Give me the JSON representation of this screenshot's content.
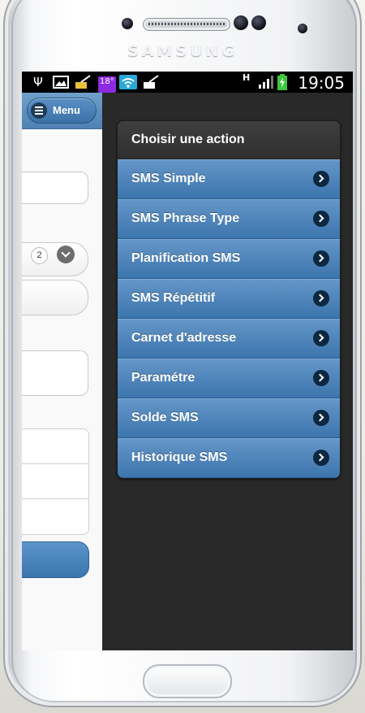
{
  "device": {
    "brand": "SAMSUNG"
  },
  "status_bar": {
    "time": "19:05",
    "temperature": "18°",
    "network": "H",
    "icons": [
      "usb-icon",
      "image-icon",
      "broom-icon",
      "temperature-badge",
      "wifi-icon",
      "clean-icon",
      "network-h-icon",
      "signal-bars-icon",
      "battery-charging-icon"
    ]
  },
  "app": {
    "header": {
      "menu_label": "Menu"
    },
    "count_badge": "2"
  },
  "panel": {
    "title": "Choisir une action",
    "items": [
      {
        "label": "SMS Simple"
      },
      {
        "label": "SMS Phrase Type"
      },
      {
        "label": "Planification SMS"
      },
      {
        "label": "SMS Répétitif"
      },
      {
        "label": "Carnet d'adresse"
      },
      {
        "label": "Paramétre"
      },
      {
        "label": "Solde SMS"
      },
      {
        "label": "Historique SMS"
      }
    ]
  },
  "colors": {
    "accent_blue": "#4a84ba",
    "panel_bg": "#292929",
    "header_blue": "#5b8fc2"
  }
}
